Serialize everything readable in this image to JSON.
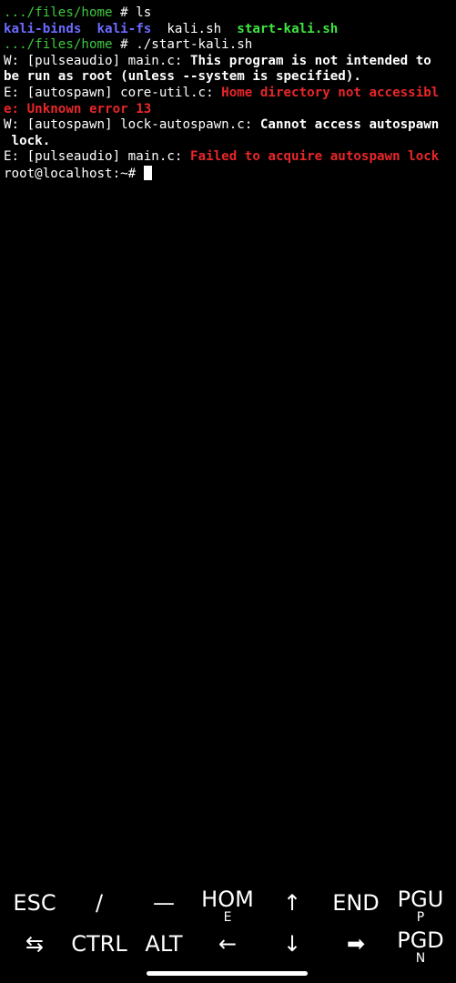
{
  "terminal": {
    "lines": [
      [
        {
          "text": ".../files/home",
          "color": "green"
        },
        {
          "text": " # ls",
          "color": "white"
        }
      ],
      [
        {
          "text": "kali-binds",
          "color": "blue"
        },
        {
          "text": "  ",
          "color": "white"
        },
        {
          "text": "kali-fs",
          "color": "blue"
        },
        {
          "text": "  kali.sh  ",
          "color": "white"
        },
        {
          "text": "start-kali.sh",
          "color": "exec"
        }
      ],
      [
        {
          "text": ".../files/home",
          "color": "green"
        },
        {
          "text": " # ./start-kali.sh",
          "color": "white"
        }
      ],
      [
        {
          "text": "W: [pulseaudio] main.c: ",
          "color": "white"
        },
        {
          "text": "This program is not intended to",
          "color": "bold"
        }
      ],
      [
        {
          "text": "be run as root (unless --system is specified).",
          "color": "bold"
        }
      ],
      [
        {
          "text": "E: [autospawn] core-util.c: ",
          "color": "white"
        },
        {
          "text": "Home directory not accessibl",
          "color": "red"
        }
      ],
      [
        {
          "text": "e: Unknown error 13",
          "color": "red"
        }
      ],
      [
        {
          "text": "W: [autospawn] lock-autospawn.c: ",
          "color": "white"
        },
        {
          "text": "Cannot access autospawn",
          "color": "bold"
        }
      ],
      [
        {
          "text": " lock.",
          "color": "bold"
        }
      ],
      [
        {
          "text": "E: [pulseaudio] main.c: ",
          "color": "white"
        },
        {
          "text": "Failed to acquire autospawn lock",
          "color": "red"
        }
      ],
      [
        {
          "text": "root@localhost:~# ",
          "color": "white"
        }
      ]
    ]
  },
  "extra_keys": {
    "row1": [
      {
        "label": "ESC",
        "name": "esc-key",
        "sub": ""
      },
      {
        "label": "/",
        "name": "slash-key",
        "sub": ""
      },
      {
        "label": "—",
        "name": "dash-key",
        "sub": ""
      },
      {
        "label": "HOM",
        "name": "home-key",
        "sub": "E"
      },
      {
        "label": "↑",
        "name": "arrow-up-key",
        "sub": ""
      },
      {
        "label": "END",
        "name": "end-key",
        "sub": ""
      },
      {
        "label": "PGU",
        "name": "page-up-key",
        "sub": "P"
      }
    ],
    "row2": [
      {
        "label": "⇆",
        "name": "tab-key",
        "sub": ""
      },
      {
        "label": "CTRL",
        "name": "ctrl-key",
        "sub": ""
      },
      {
        "label": "ALT",
        "name": "alt-key",
        "sub": ""
      },
      {
        "label": "←",
        "name": "arrow-left-key",
        "sub": ""
      },
      {
        "label": "↓",
        "name": "arrow-down-key",
        "sub": ""
      },
      {
        "label": "➡",
        "name": "arrow-right-key",
        "sub": ""
      },
      {
        "label": "PGD",
        "name": "page-down-key",
        "sub": "N"
      }
    ]
  },
  "colors": {
    "background": "#000000",
    "green": "#3ec93e",
    "blue": "#6b6bff",
    "exec": "#3ee63e",
    "red": "#e8262a",
    "white": "#ffffff"
  }
}
